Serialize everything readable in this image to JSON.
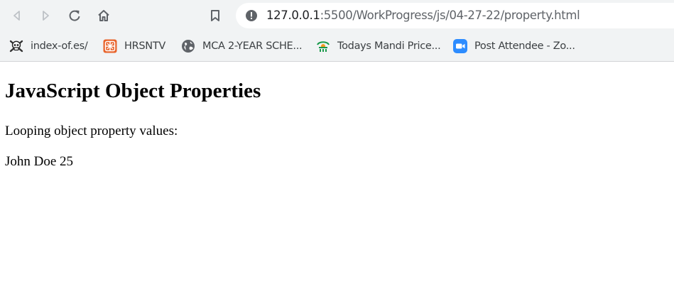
{
  "browser": {
    "url_host": "127.0.0.1",
    "url_path": ":5500/WorkProgress/js/04-27-22/property.html",
    "icons": {
      "back": "arrow-back-icon",
      "forward": "arrow-forward-icon",
      "reload": "reload-icon",
      "home": "home-icon",
      "bookmark": "bookmark-icon",
      "info": "info-icon"
    }
  },
  "bookmarks": [
    {
      "label": "index-of.es/",
      "icon": "skull-icon"
    },
    {
      "label": "HRSNTV",
      "icon": "grid-logo-icon"
    },
    {
      "label": "MCA 2-YEAR SCHE...",
      "icon": "globe-icon"
    },
    {
      "label": "Todays Mandi Price...",
      "icon": "mandi-logo-icon"
    },
    {
      "label": "Post Attendee - Zo...",
      "icon": "zoom-camera-icon"
    }
  ],
  "page": {
    "heading": "JavaScript Object Properties",
    "paragraph": "Looping object property values:",
    "output": "John Doe 25"
  },
  "colors": {
    "toolbar_bg": "#f1f3f4",
    "icon_gray": "#5f6368",
    "zoom_blue": "#2d8cff",
    "hrsntv_orange": "#e8642c"
  }
}
